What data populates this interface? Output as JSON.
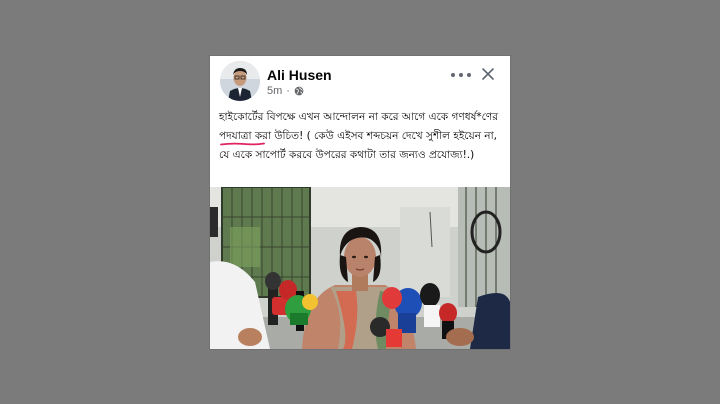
{
  "post": {
    "author": "Ali Husen",
    "time": "5m",
    "separator": "·",
    "body": "হাইকোর্টের বিপক্ষে এখন আন্দোলন না করে আগে একে গণধর্ষ*ণের পদযাত্রা করা উচিত! ( কেউ এইসব শব্দচয়ন দেখে সুশীল হইয়েন না, যে একে সাপোর্ট করবে উপরের কথাটা তার জন্যও প্রযোজ্য!.)"
  },
  "icons": {
    "globe": "globe-icon",
    "more": "more-options-icon",
    "close": "close-icon"
  },
  "colors": {
    "background": "#7b7b7b",
    "card": "#ffffff",
    "underline": "#e0245e"
  }
}
